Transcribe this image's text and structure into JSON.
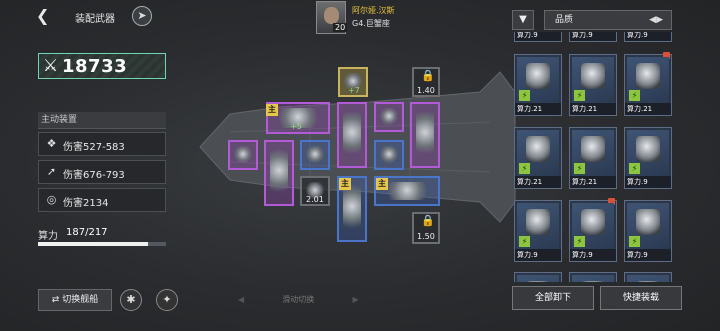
{
  "header": {
    "back_icon": "back-arrow-icon",
    "title": "装配武器",
    "title_icon": "missile-icon"
  },
  "commander": {
    "name": "阿尔娅.汉斯",
    "subtitle": "G4.巨蟹座",
    "level": "20"
  },
  "power": {
    "icon": "crossed-swords-icon",
    "value": "18733"
  },
  "active_section": {
    "title": "主动装置",
    "stats": [
      {
        "icon": "claw-icon",
        "label": "伤害527-583"
      },
      {
        "icon": "missile-icon",
        "label": "伤害676-793"
      },
      {
        "icon": "radar-icon",
        "label": "伤害2134"
      }
    ]
  },
  "computing": {
    "label": "算力",
    "value": "187/217",
    "used": 187,
    "max": 217
  },
  "bottom_left": {
    "switch_label": "切换舰船",
    "swipe_label": "滑动切换"
  },
  "ship": {
    "main_tag": "主",
    "locked": [
      {
        "value": "1.40"
      },
      {
        "value": "1.50"
      }
    ],
    "slot_level": "2.01",
    "plus_values": [
      "+7",
      "+5"
    ]
  },
  "right_panel": {
    "quality_label": "品质",
    "top_row_labels": [
      "算力.9",
      "算力.9",
      "算力.9"
    ],
    "cards": [
      {
        "label": "算力.21",
        "new": false
      },
      {
        "label": "算力.21",
        "new": false
      },
      {
        "label": "算力.21",
        "new": true
      },
      {
        "label": "算力.21",
        "new": false
      },
      {
        "label": "算力.21",
        "new": false
      },
      {
        "label": "算力.9",
        "new": false
      },
      {
        "label": "算力.9",
        "new": false
      },
      {
        "label": "算力.9",
        "new": true
      },
      {
        "label": "算力.9",
        "new": false
      }
    ],
    "unload_all": "全部卸下",
    "quick_equip": "快捷装载"
  },
  "colors": {
    "accent_green": "#6fd6b4",
    "gold": "#f0c73b",
    "purple_slot": "#b35bd6",
    "blue_slot": "#4a76c9"
  }
}
